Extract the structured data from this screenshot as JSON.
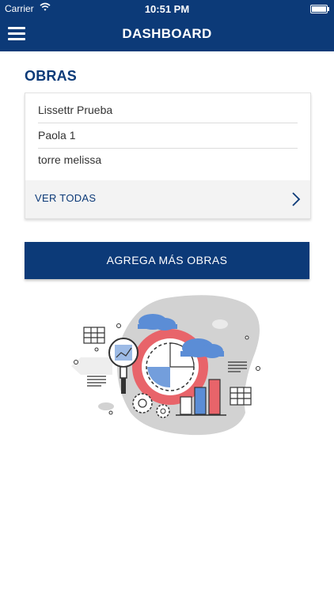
{
  "status_bar": {
    "carrier": "Carrier",
    "time": "10:51 PM"
  },
  "header": {
    "title": "DASHBOARD",
    "menu_icon": "hamburger-icon"
  },
  "obras": {
    "title": "OBRAS",
    "items": [
      "Lissettr Prueba",
      "Paola 1",
      "torre melissa"
    ],
    "see_all_label": "VER TODAS"
  },
  "cta": {
    "label": "AGREGA MÁS OBRAS"
  },
  "colors": {
    "primary": "#0c3a78",
    "accent_red": "#e8646a",
    "accent_blue": "#5b8dd6",
    "gray_blob": "#d2d2d2"
  }
}
